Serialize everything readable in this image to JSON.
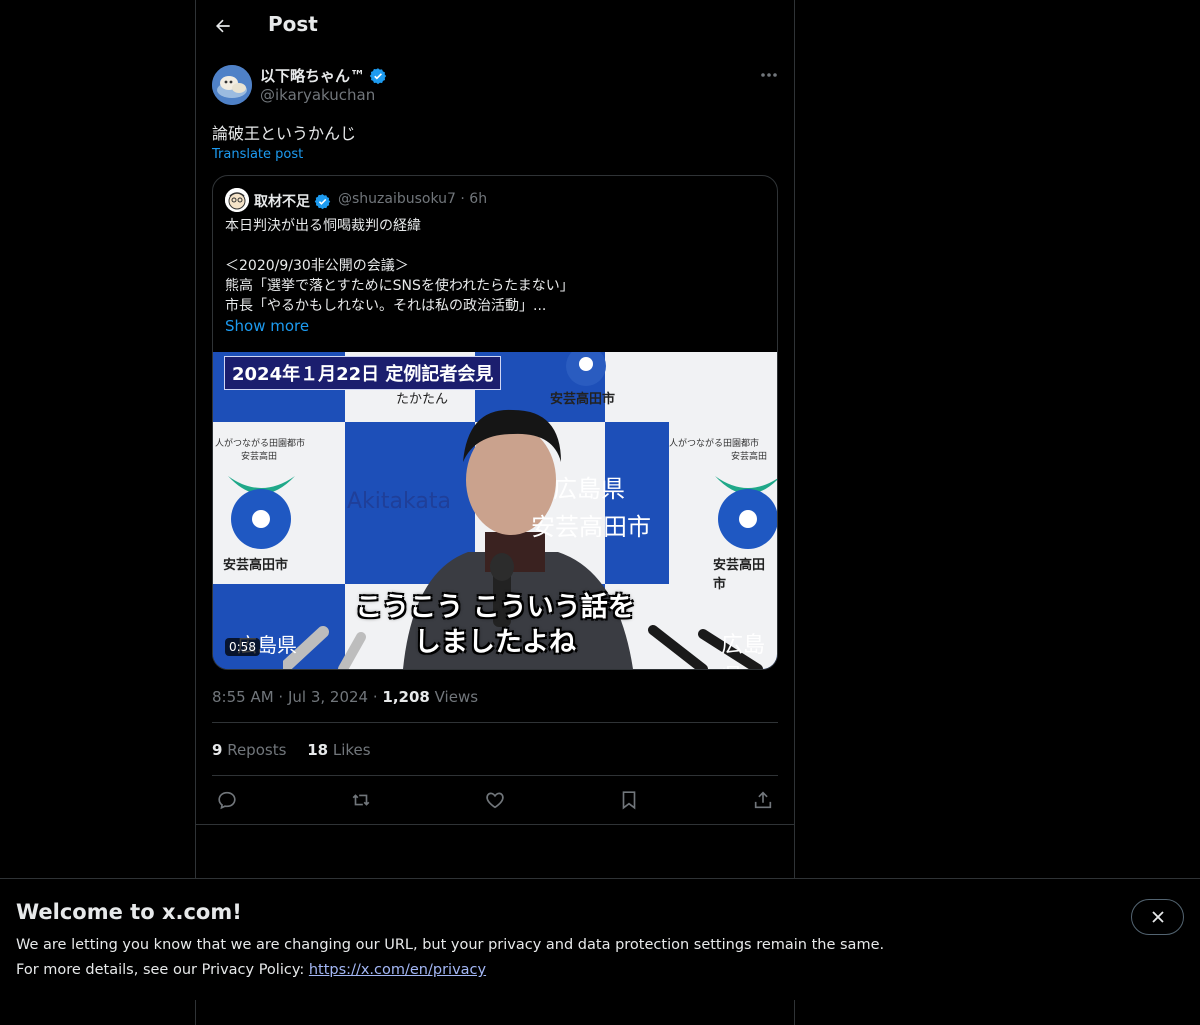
{
  "header": {
    "title": "Post"
  },
  "author": {
    "name": "以下略ちゃん™",
    "handle": "@ikaryakuchan"
  },
  "post": {
    "text": "論破王というかんじ",
    "translate_label": "Translate post",
    "timestamp": "8:55 AM · Jul 3, 2024 · ",
    "views_count": "1,208",
    "views_label": " Views"
  },
  "quoted": {
    "name": "取材不足",
    "handle_time": "@shuzaibusoku7 · 6h",
    "lines": [
      "本日判決が出る恫喝裁判の経緯",
      "",
      "＜2020/9/30非公開の会議＞",
      "熊高「選挙で落とすためにSNSを使われたらたまない」",
      "市長「やるかもしれない。それは私の政治活動」..."
    ],
    "show_more": "Show more",
    "video": {
      "title_badge": "2024年１月22日 定例記者会見",
      "subtitle_line1": "こうこう こういう話を",
      "subtitle_line2": "しましたよね",
      "duration": "0:58",
      "backdrop_text": {
        "takatan": "たかたん",
        "city_top": "安芸高田市",
        "slogan": "人がつながる田園都市",
        "city_short": "安芸高田",
        "akitakata": "Akitakata",
        "pref": "広島県",
        "city_bottom": "安芸高田市",
        "pref_partial": "広島県"
      }
    }
  },
  "stats": {
    "reposts_count": "9",
    "reposts_label": " Reposts",
    "likes_count": "18",
    "likes_label": " Likes"
  },
  "actions": [
    "reply",
    "repost",
    "like",
    "bookmark",
    "share"
  ],
  "banner": {
    "title": "Welcome to x.com!",
    "line1": "We are letting you know that we are changing our URL, but your privacy and data protection settings remain the same.",
    "line2_prefix": "For more details, see our Privacy Policy: ",
    "link": "https://x.com/en/privacy"
  },
  "colors": {
    "accent": "#1d9bf0",
    "verified": "#1d9bf0",
    "muted": "#71767b",
    "border": "#2f3336",
    "background": "#000000"
  }
}
